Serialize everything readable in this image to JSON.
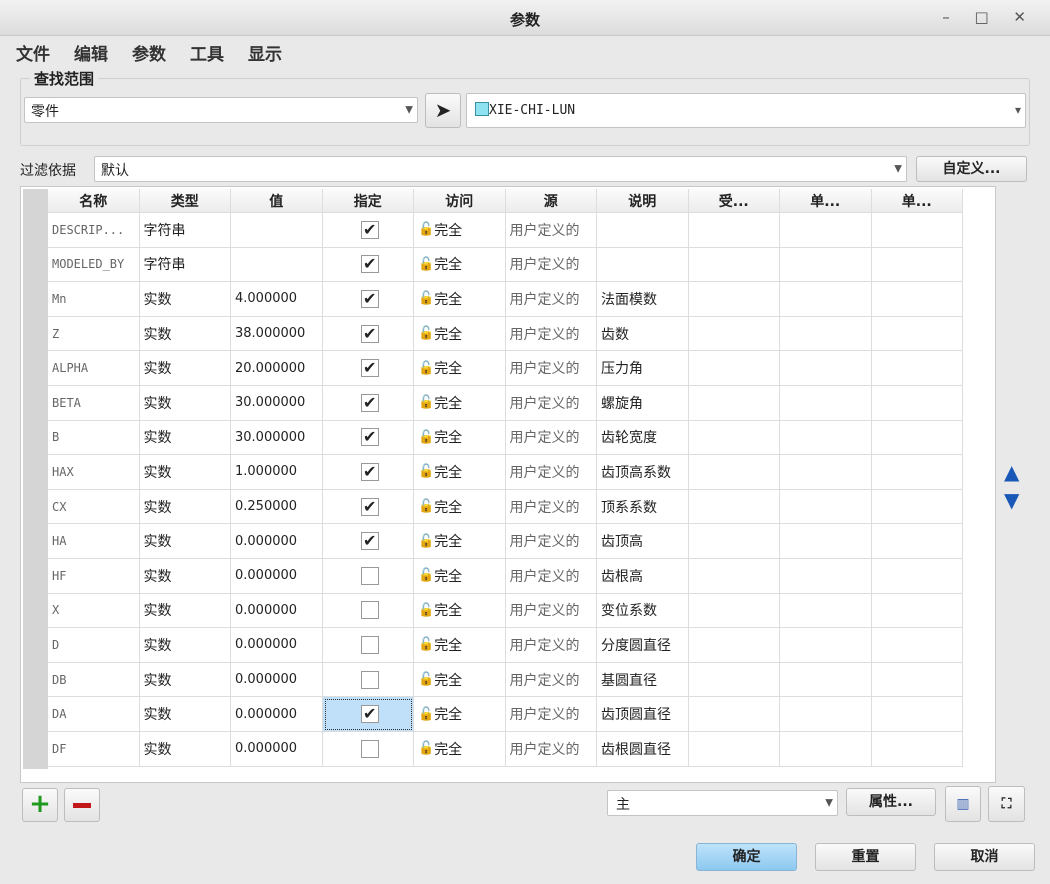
{
  "window": {
    "title": "参数",
    "controls": "– □ ✕"
  },
  "menu": [
    "文件",
    "编辑",
    "参数",
    "工具",
    "显示"
  ],
  "lookin": {
    "label": "查找范围",
    "scope": "零件",
    "model": "XIE-CHI-LUN"
  },
  "filter": {
    "label": "过滤依据",
    "value": "默认",
    "custom_button": "自定义..."
  },
  "columns": [
    "名称",
    "类型",
    "值",
    "指定",
    "访问",
    "源",
    "说明",
    "受...",
    "单...",
    "单..."
  ],
  "rows": [
    {
      "name": "DESCRIP...",
      "type": "字符串",
      "value": "",
      "designated": true,
      "access": "完全",
      "source": "用户定义的",
      "desc": ""
    },
    {
      "name": "MODELED_BY",
      "type": "字符串",
      "value": "",
      "designated": true,
      "access": "完全",
      "source": "用户定义的",
      "desc": ""
    },
    {
      "name": "Mn",
      "type": "实数",
      "value": "4.000000",
      "designated": true,
      "access": "完全",
      "source": "用户定义的",
      "desc": "法面模数"
    },
    {
      "name": "Z",
      "type": "实数",
      "value": "38.000000",
      "designated": true,
      "access": "完全",
      "source": "用户定义的",
      "desc": "齿数"
    },
    {
      "name": "ALPHA",
      "type": "实数",
      "value": "20.000000",
      "designated": true,
      "access": "完全",
      "source": "用户定义的",
      "desc": "压力角"
    },
    {
      "name": "BETA",
      "type": "实数",
      "value": "30.000000",
      "designated": true,
      "access": "完全",
      "source": "用户定义的",
      "desc": "螺旋角"
    },
    {
      "name": "B",
      "type": "实数",
      "value": "30.000000",
      "designated": true,
      "access": "完全",
      "source": "用户定义的",
      "desc": "齿轮宽度"
    },
    {
      "name": "HAX",
      "type": "实数",
      "value": "1.000000",
      "designated": true,
      "access": "完全",
      "source": "用户定义的",
      "desc": "齿顶高系数"
    },
    {
      "name": "CX",
      "type": "实数",
      "value": "0.250000",
      "designated": true,
      "access": "完全",
      "source": "用户定义的",
      "desc": "顶系系数"
    },
    {
      "name": "HA",
      "type": "实数",
      "value": "0.000000",
      "designated": true,
      "access": "完全",
      "source": "用户定义的",
      "desc": "齿顶高"
    },
    {
      "name": "HF",
      "type": "实数",
      "value": "0.000000",
      "designated": false,
      "access": "完全",
      "source": "用户定义的",
      "desc": "齿根高"
    },
    {
      "name": "X",
      "type": "实数",
      "value": "0.000000",
      "designated": false,
      "access": "完全",
      "source": "用户定义的",
      "desc": "变位系数"
    },
    {
      "name": "D",
      "type": "实数",
      "value": "0.000000",
      "designated": false,
      "access": "完全",
      "source": "用户定义的",
      "desc": "分度圆直径"
    },
    {
      "name": "DB",
      "type": "实数",
      "value": "0.000000",
      "designated": false,
      "access": "完全",
      "source": "用户定义的",
      "desc": "基圆直径"
    },
    {
      "name": "DA",
      "type": "实数",
      "value": "0.000000",
      "designated": true,
      "access": "完全",
      "source": "用户定义的",
      "desc": "齿顶圆直径",
      "selected": true
    },
    {
      "name": "DF",
      "type": "实数",
      "value": "0.000000",
      "designated": false,
      "access": "完全",
      "source": "用户定义的",
      "desc": "齿根圆直径"
    }
  ],
  "bottom": {
    "set": "主",
    "properties_button": "属性..."
  },
  "footer": {
    "ok": "确定",
    "reset": "重置",
    "cancel": "取消"
  }
}
